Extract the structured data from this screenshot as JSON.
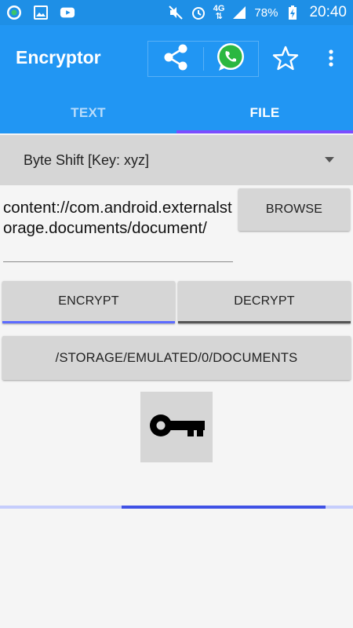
{
  "status_bar": {
    "left_icons": [
      "chat-app-icon",
      "gallery-icon",
      "youtube-icon"
    ],
    "right_icons": [
      "mute-icon",
      "alarm-icon",
      "network-4g-icon",
      "signal-icon",
      "battery-charging-icon"
    ],
    "network": "4G",
    "battery": "78%",
    "time": "20:40"
  },
  "app_bar": {
    "title": "Encryptor",
    "actions": [
      "share-icon",
      "whatsapp-icon",
      "star-icon",
      "more-vert-icon"
    ],
    "colors": {
      "primary": "#2196f3",
      "status": "#1e8fe6",
      "accent": "#7c4dff"
    }
  },
  "tabs": [
    {
      "label": "TEXT",
      "selected": false
    },
    {
      "label": "FILE",
      "selected": true
    }
  ],
  "cipher_spinner": {
    "selected": "Byte Shift [Key: xyz]"
  },
  "file_path": {
    "value": "content://com.android.externalstorage.documents/document/"
  },
  "buttons": {
    "browse": "BROWSE",
    "encrypt": "ENCRYPT",
    "decrypt": "DECRYPT",
    "output_path": "/STORAGE/EMULATED/0/DOCUMENTS"
  },
  "key_icon": "key-icon",
  "progress": {
    "indeterminate": true,
    "segment_start": 0.345,
    "segment_end": 0.922
  }
}
